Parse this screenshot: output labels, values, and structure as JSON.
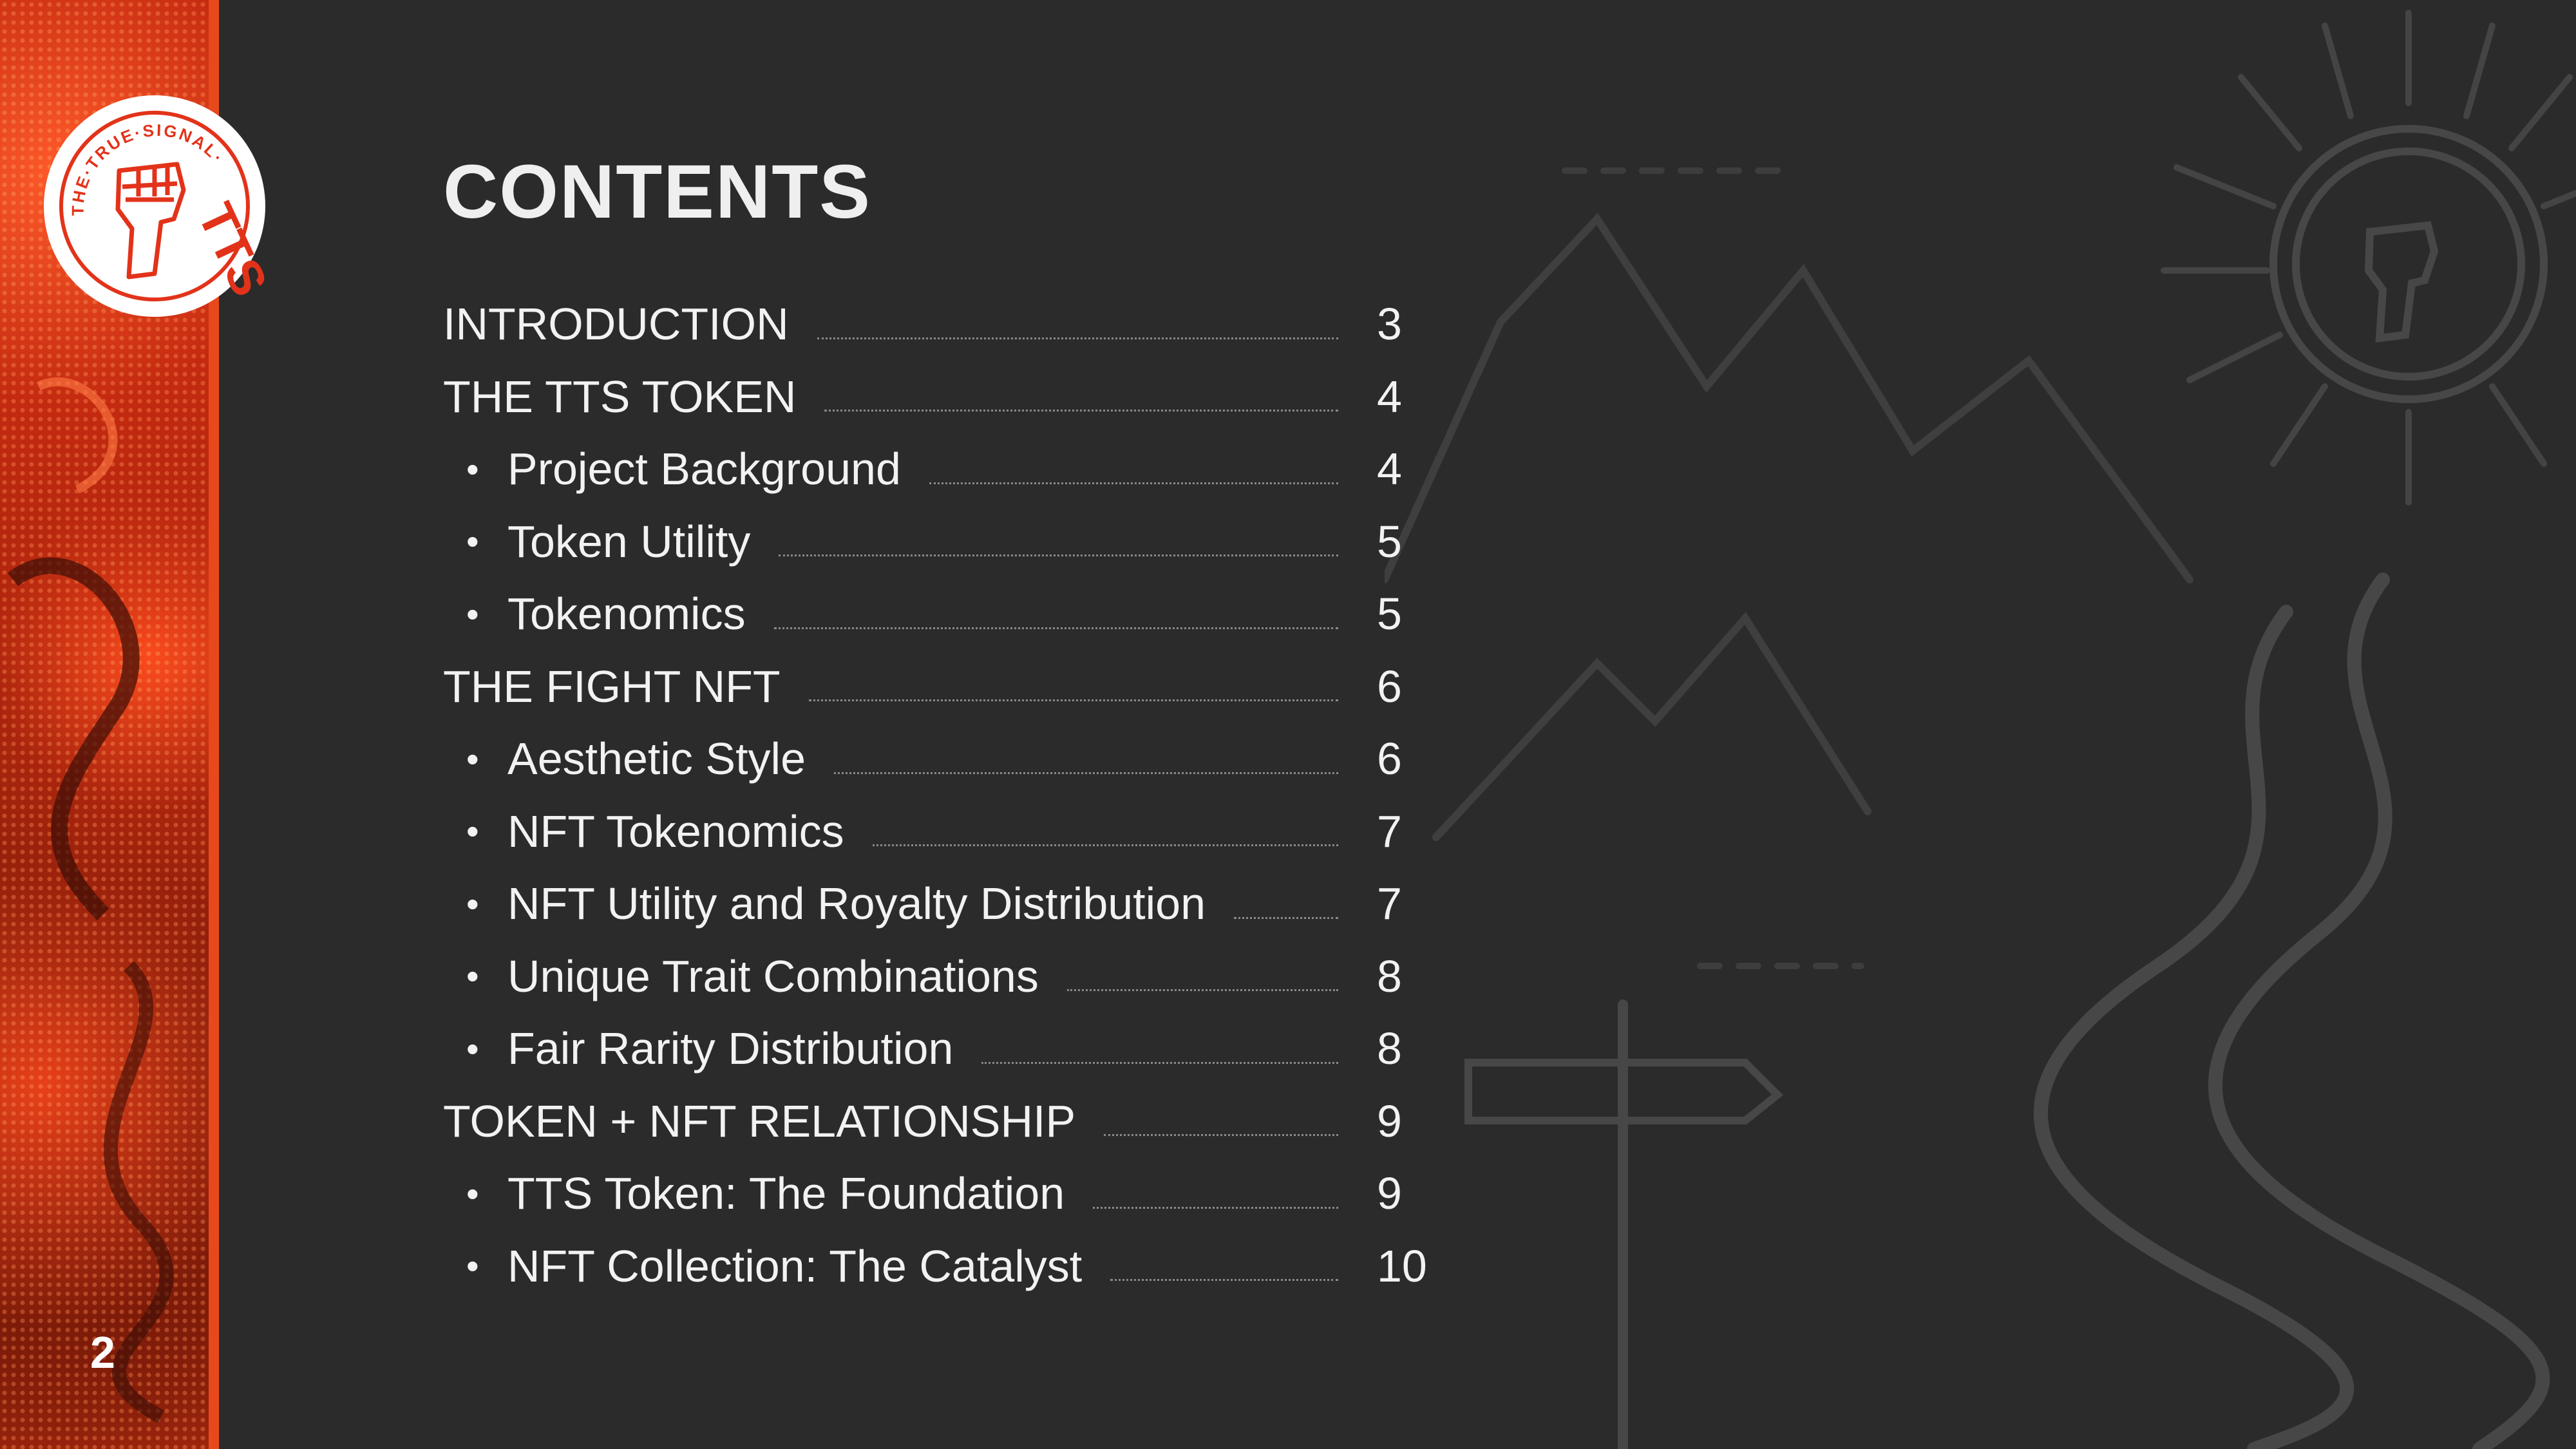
{
  "page": {
    "number": "2",
    "title": "CONTENTS"
  },
  "logo": {
    "text_top": "THE·TRUE·SIGNAL·",
    "text_side": "TTS",
    "icon": "raised-fist-icon"
  },
  "colors": {
    "background": "#2b2b2b",
    "accent": "#e8491c",
    "text": "#f2f2f2",
    "decor": "#4a4a4a"
  },
  "toc": [
    {
      "label": "INTRODUCTION",
      "page": "3",
      "level": 0
    },
    {
      "label": "THE TTS TOKEN",
      "page": "4",
      "level": 0
    },
    {
      "label": "Project Background",
      "page": "4",
      "level": 1
    },
    {
      "label": "Token Utility",
      "page": "5",
      "level": 1
    },
    {
      "label": "Tokenomics",
      "page": "5",
      "level": 1
    },
    {
      "label": "THE FIGHT NFT",
      "page": "6",
      "level": 0
    },
    {
      "label": "Aesthetic Style",
      "page": "6",
      "level": 1
    },
    {
      "label": "NFT Tokenomics",
      "page": "7",
      "level": 1
    },
    {
      "label": "NFT Utility and Royalty Distribution",
      "page": "7",
      "level": 1
    },
    {
      "label": "Unique Trait Combinations",
      "page": "8",
      "level": 1
    },
    {
      "label": "Fair Rarity Distribution",
      "page": "8",
      "level": 1
    },
    {
      "label": "TOKEN + NFT RELATIONSHIP",
      "page": "9",
      "level": 0
    },
    {
      "label": "TTS Token: The Foundation",
      "page": "9",
      "level": 1
    },
    {
      "label": "NFT Collection: The Catalyst",
      "page": "10",
      "level": 1
    }
  ]
}
